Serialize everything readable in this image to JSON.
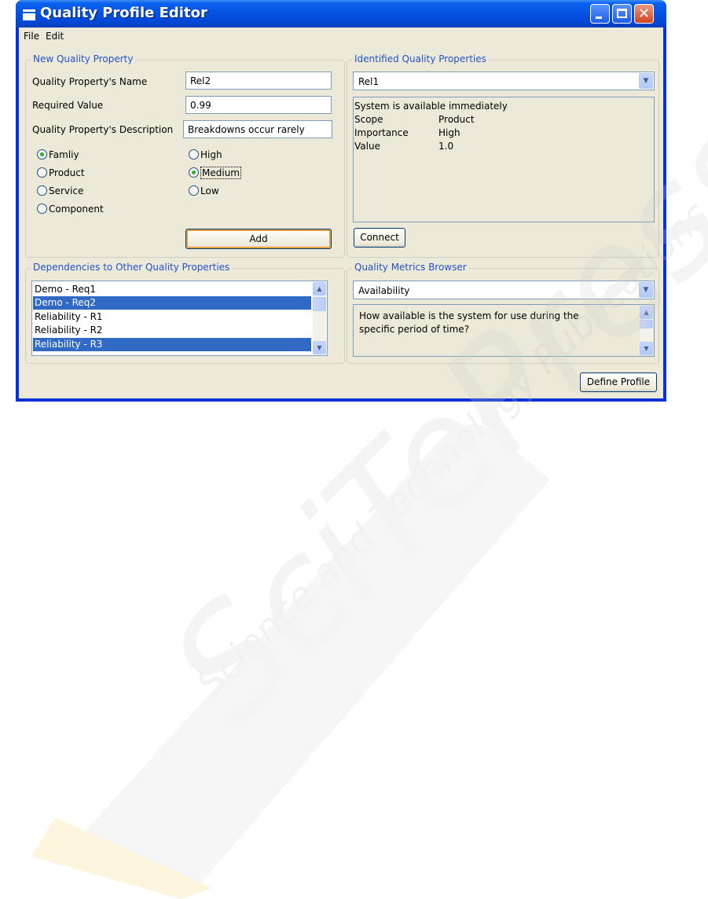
{
  "window": {
    "title": "Quality Profile Editor"
  },
  "menu": [
    "File",
    "Edit"
  ],
  "new_property": {
    "group_title": "New Quality Property",
    "name_label": "Quality Property's Name",
    "name_value": "Rel2",
    "required_label": "Required Value",
    "required_value": "0.99",
    "description_label": "Quality Property's Description",
    "description_value": "Breakdowns occur rarely",
    "scope_options": [
      {
        "label": "Famliy",
        "checked": true
      },
      {
        "label": "Product",
        "checked": false
      },
      {
        "label": "Service",
        "checked": false
      },
      {
        "label": "Component",
        "checked": false
      }
    ],
    "importance_options": [
      {
        "label": "High",
        "checked": false
      },
      {
        "label": "Medium",
        "checked": true
      },
      {
        "label": "Low",
        "checked": false
      }
    ],
    "add_label": "Add"
  },
  "identified": {
    "group_title": "Identified Quality Properties",
    "selected": "Rel1",
    "description": "System is available immediately",
    "details": [
      {
        "key": "Scope",
        "value": "Product"
      },
      {
        "key": "Importance",
        "value": "High"
      },
      {
        "key": "Value",
        "value": "1.0"
      }
    ],
    "connect_label": "Connect"
  },
  "dependencies": {
    "group_title": "Dependencies to Other Quality Properties",
    "items": [
      {
        "label": "Demo - Req1",
        "selected": false
      },
      {
        "label": "Demo - Req2",
        "selected": true
      },
      {
        "label": "Reliability - R1",
        "selected": false
      },
      {
        "label": "Reliability - R2",
        "selected": false
      },
      {
        "label": "Reliability - R3",
        "selected": true
      }
    ]
  },
  "metrics": {
    "group_title": "Quality Metrics Browser",
    "selected": "Availability",
    "description_lines": [
      "How available is the system for use during the",
      "specific period of time?"
    ]
  },
  "define_profile_label": "Define Profile",
  "watermark": {
    "text_large": "SciTePress",
    "text_small": "Science and Technology Publications"
  }
}
